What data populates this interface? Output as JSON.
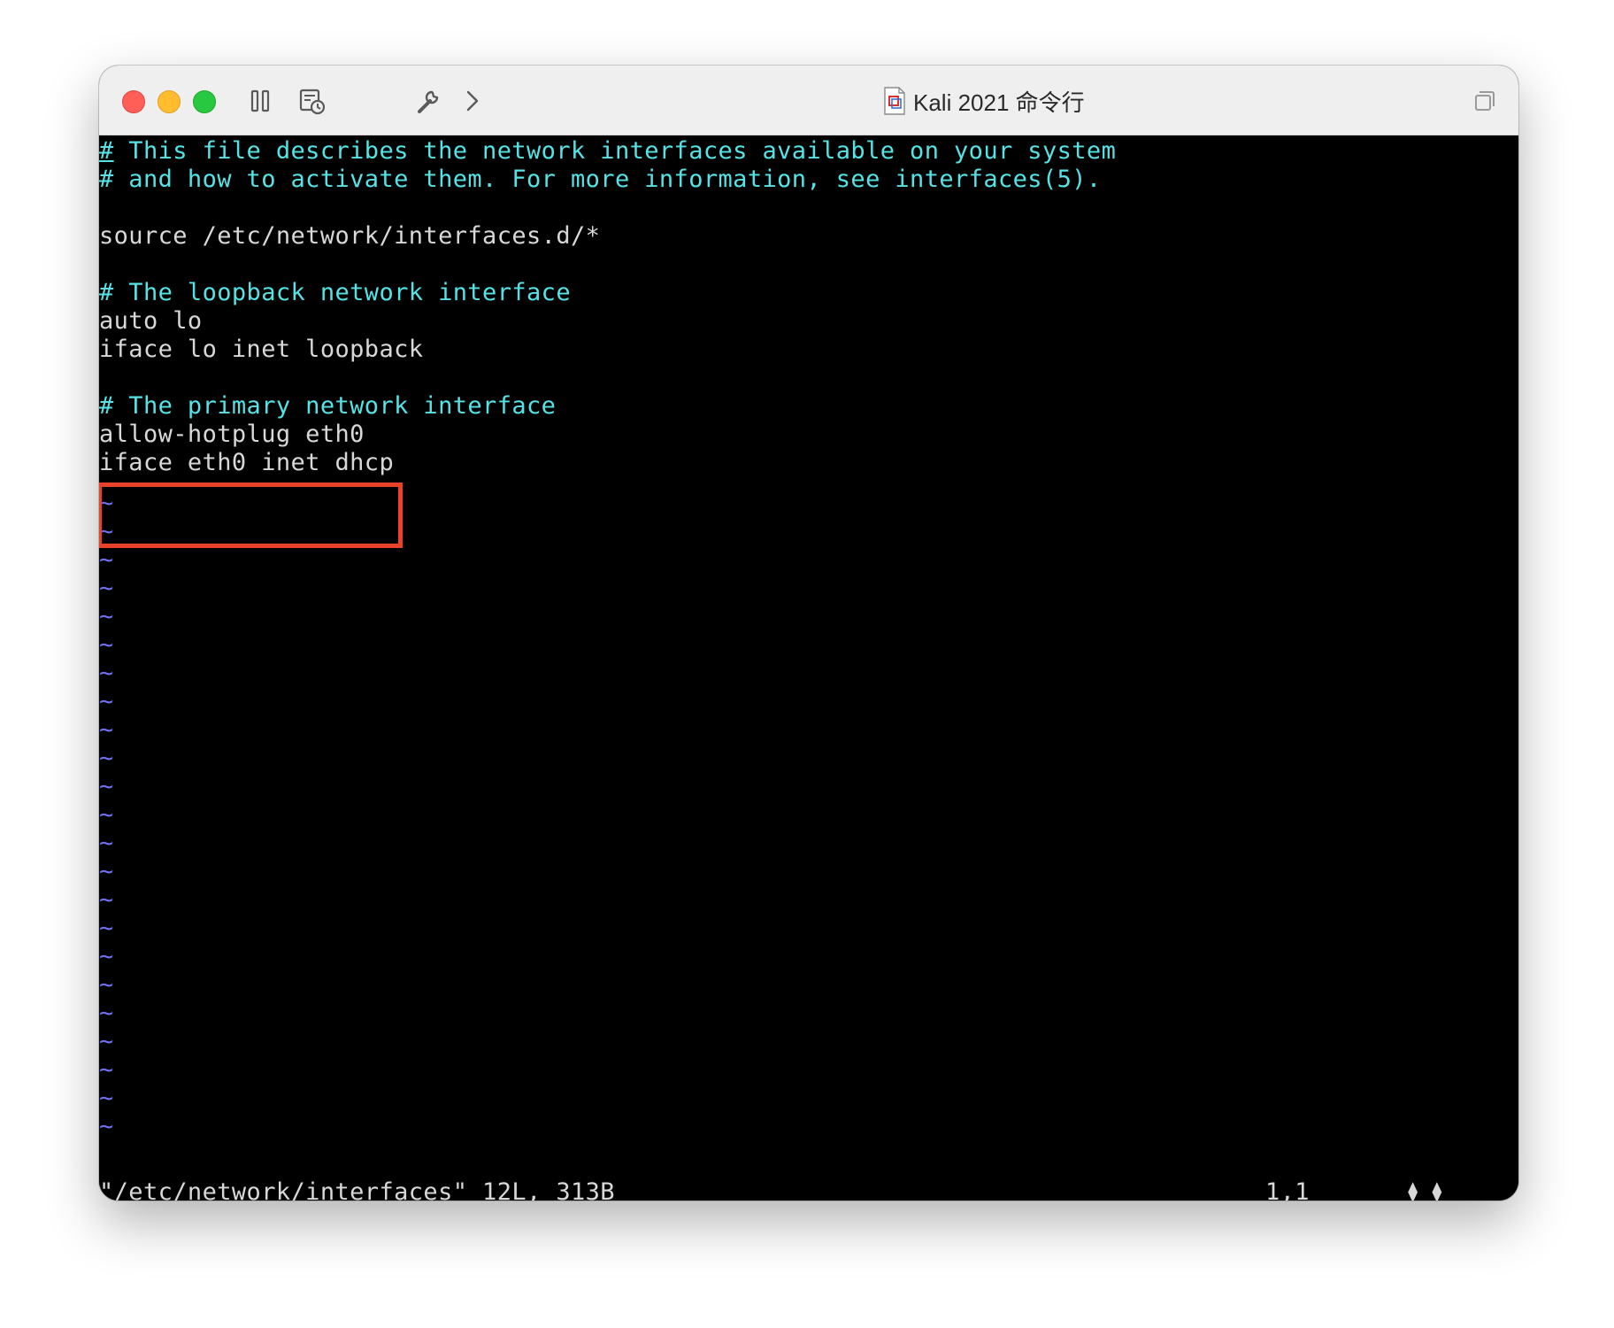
{
  "window": {
    "title": "Kali 2021 命令行"
  },
  "editor": {
    "lines": [
      {
        "text": "# This file describes the network interfaces available on your system",
        "kind": "comment"
      },
      {
        "text": "# and how to activate them. For more information, see interfaces(5).",
        "kind": "comment"
      },
      {
        "text": "",
        "kind": "normal"
      },
      {
        "text": "source /etc/network/interfaces.d/*",
        "kind": "normal"
      },
      {
        "text": "",
        "kind": "normal"
      },
      {
        "text": "# The loopback network interface",
        "kind": "comment"
      },
      {
        "text": "auto lo",
        "kind": "normal"
      },
      {
        "text": "iface lo inet loopback",
        "kind": "normal"
      },
      {
        "text": "",
        "kind": "normal"
      },
      {
        "text": "# The primary network interface",
        "kind": "comment"
      },
      {
        "text": "allow-hotplug eth0",
        "kind": "normal"
      },
      {
        "text": "iface eth0 inet dhcp",
        "kind": "normal"
      }
    ],
    "empty_line_marker": "~",
    "empty_line_count": 23
  },
  "status": {
    "file_info": "\"/etc/network/interfaces\" 12L, 313B",
    "cursor_position": "1,1",
    "scroll_indicator": "⧫ ⧫"
  },
  "colors": {
    "comment": "#56e3e6",
    "normal": "#d8d8d8",
    "tilde": "#6e6ef0",
    "highlight": "#e8432a"
  }
}
